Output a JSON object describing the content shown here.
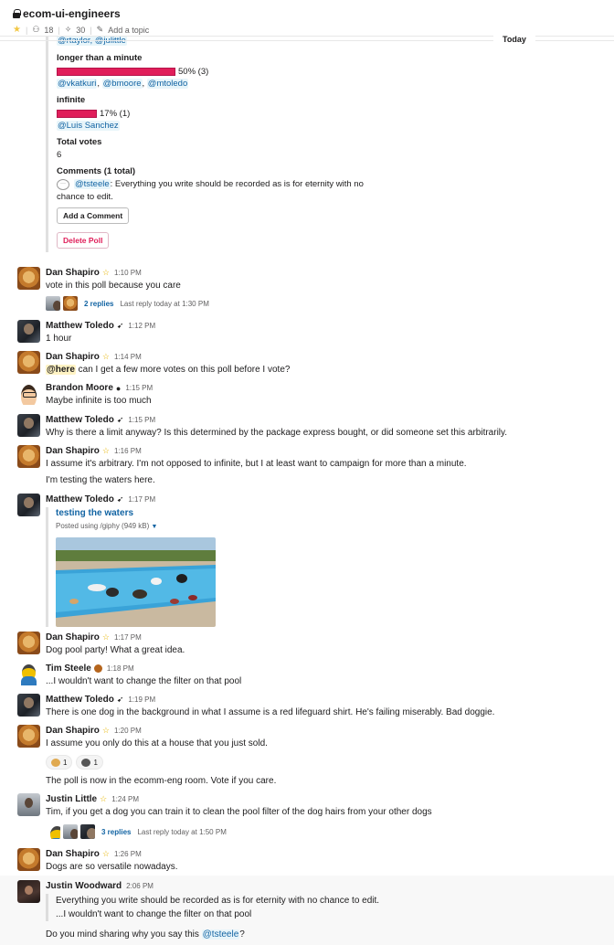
{
  "header": {
    "channel": "ecom-ui-engineers",
    "members": "18",
    "pins": "30",
    "add_topic": "Add a topic"
  },
  "divider": {
    "label": "Today"
  },
  "poll": {
    "prev_voters": "@rtaylor, @julittle",
    "option2": {
      "label": "longer than a minute",
      "percent": 50,
      "result": "50% (3)",
      "voters": [
        "@vkatkuri",
        "@bmoore",
        "@mtoledo"
      ]
    },
    "option3": {
      "label": "infinite",
      "percent": 17,
      "result": "17% (1)",
      "voters": [
        "@Luis Sanchez"
      ]
    },
    "total_label": "Total votes",
    "total": "6",
    "comments_label": "Comments (1 total)",
    "comment_author": "@tsteele",
    "comment_text": ": Everything you write should be recorded as is for eternity with no",
    "comment_text2": "chance to edit.",
    "add_comment": "Add a Comment",
    "delete_poll": "Delete Poll"
  },
  "messages": [
    {
      "name": "Dan Shapiro",
      "time": "1:10 PM",
      "text": "vote in this poll because you care",
      "thread_replies": "2 replies",
      "thread_last": "Last reply today at 1:30 PM"
    },
    {
      "name": "Matthew Toledo",
      "time": "1:12 PM",
      "text": "1 hour"
    },
    {
      "name": "Dan Shapiro",
      "time": "1:14 PM",
      "mention": "@here",
      "text": " can I get a few more votes on this poll before I vote?"
    },
    {
      "name": "Brandon Moore",
      "time": "1:15 PM",
      "text": "Maybe infinite is too much"
    },
    {
      "name": "Matthew Toledo",
      "time": "1:15 PM",
      "text": "Why is there a limit anyway?  Is this determined by the package express bought, or did someone set this arbitrarily."
    },
    {
      "name": "Dan Shapiro",
      "time": "1:16 PM",
      "text": "I assume it's arbitrary. I'm not opposed to infinite, but I at least want to campaign for more than a minute.",
      "text2": "I'm testing the waters here."
    },
    {
      "name": "Matthew Toledo",
      "time": "1:17 PM",
      "attach_title": "testing the waters",
      "attach_sub": "Posted using /giphy (949 kB)"
    },
    {
      "name": "Dan Shapiro",
      "time": "1:17 PM",
      "text": "Dog pool party! What a great idea."
    },
    {
      "name": "Tim Steele",
      "time": "1:18 PM",
      "text": "...I wouldn't want to change the filter on that pool"
    },
    {
      "name": "Matthew Toledo",
      "time": "1:19 PM",
      "text": "There is one dog in the background in what I assume is a red lifeguard shirt.  He's failing miserably.  Bad doggie."
    },
    {
      "name": "Dan Shapiro",
      "time": "1:20 PM",
      "text": "I assume you only do this at a house that you just sold.",
      "reaction1": "1",
      "reaction2": "1",
      "text2": "The poll is now in the ecomm-eng room. Vote if you care."
    },
    {
      "name": "Justin Little",
      "time": "1:24 PM",
      "text": "Tim, if you get a dog you can train it to clean the pool filter of the dog hairs from your other dogs",
      "thread_replies": "3 replies",
      "thread_last": "Last reply today at 1:50 PM"
    },
    {
      "name": "Dan Shapiro",
      "time": "1:26 PM",
      "text": "Dogs are so versatile nowadays."
    },
    {
      "name": "Justin Woodward",
      "time": "2:06 PM",
      "quote1": "Everything you write should be recorded as is for eternity with no chance to edit.",
      "quote2": "...I wouldn't want to change the filter on that pool",
      "text": "Do you mind sharing why you say this ",
      "mention": "@tsteele",
      "text_end": "?"
    }
  ]
}
